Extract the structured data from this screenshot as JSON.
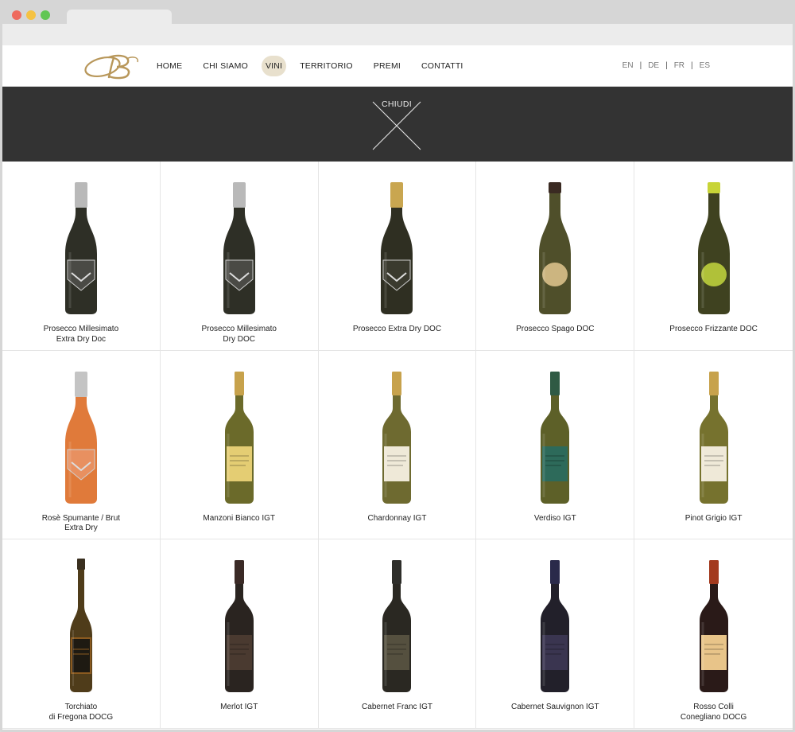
{
  "nav": {
    "items": [
      {
        "label": "HOME",
        "active": false
      },
      {
        "label": "CHI SIAMO",
        "active": false
      },
      {
        "label": "VINI",
        "active": true
      },
      {
        "label": "TERRITORIO",
        "active": false
      },
      {
        "label": "PREMI",
        "active": false
      },
      {
        "label": "CONTATTI",
        "active": false
      }
    ]
  },
  "languages": [
    "EN",
    "DE",
    "FR",
    "ES"
  ],
  "close_label": "CHIUDI",
  "colors": {
    "accent": "#e8e0cd",
    "logo_gold": "#b8975a",
    "dark_bar": "#333333"
  },
  "wines": [
    {
      "name_line1": "Prosecco Millesimato",
      "name_line2": "Extra Dry Doc",
      "bottle": "sparkling",
      "glass": "#2e2f26",
      "cap": "#b9b9b9",
      "label": "#4a4a45"
    },
    {
      "name_line1": "Prosecco Millesimato",
      "name_line2": "Dry DOC",
      "bottle": "sparkling",
      "glass": "#2e2f26",
      "cap": "#b9b9b9",
      "label": "#4a4a45"
    },
    {
      "name_line1": "Prosecco Extra Dry DOC",
      "name_line2": "",
      "bottle": "sparkling",
      "glass": "#2f2f22",
      "cap": "#c9a650",
      "label": "#3a3a2e"
    },
    {
      "name_line1": "Prosecco Spago DOC",
      "name_line2": "",
      "bottle": "spago",
      "glass": "#4f4f2a",
      "cap": "#3a2a22",
      "label": "#d9c08a"
    },
    {
      "name_line1": "Prosecco Frizzante DOC",
      "name_line2": "",
      "bottle": "spago",
      "glass": "#3f4220",
      "cap": "#c8d437",
      "label": "#bccf3c"
    },
    {
      "name_line1": "Rosè Spumante / Brut",
      "name_line2": "Extra Dry",
      "bottle": "sparkling",
      "glass": "#e07a3a",
      "cap": "#c4c4c4",
      "label": "#e89060"
    },
    {
      "name_line1": "Manzoni Bianco IGT",
      "name_line2": "",
      "bottle": "still",
      "glass": "#6b6a2a",
      "cap": "#c7a24c",
      "label": "#e4cd73"
    },
    {
      "name_line1": "Chardonnay IGT",
      "name_line2": "",
      "bottle": "still",
      "glass": "#6e6a30",
      "cap": "#c7a24c",
      "label": "#efe9d8"
    },
    {
      "name_line1": "Verdiso IGT",
      "name_line2": "",
      "bottle": "still",
      "glass": "#5d6028",
      "cap": "#2f5a44",
      "label": "#2d6a5a"
    },
    {
      "name_line1": "Pinot Grigio IGT",
      "name_line2": "",
      "bottle": "still",
      "glass": "#76722e",
      "cap": "#c7a24c",
      "label": "#efe9d8"
    },
    {
      "name_line1": "Torchiato",
      "name_line2": "di Fregona DOCG",
      "bottle": "tall",
      "glass": "#4f3c1a",
      "cap": "#3a3020",
      "label": "#8a5a20"
    },
    {
      "name_line1": "Merlot IGT",
      "name_line2": "",
      "bottle": "still",
      "glass": "#2a2420",
      "cap": "#3a2a26",
      "label": "#4a3a30"
    },
    {
      "name_line1": "Cabernet Franc IGT",
      "name_line2": "",
      "bottle": "still",
      "glass": "#2a2822",
      "cap": "#2e2e2a",
      "label": "#55503f"
    },
    {
      "name_line1": "Cabernet Sauvignon IGT",
      "name_line2": "",
      "bottle": "still",
      "glass": "#22202a",
      "cap": "#2a2a4a",
      "label": "#3a3550"
    },
    {
      "name_line1": "Rosso Colli",
      "name_line2": "Conegliano DOCG",
      "bottle": "still",
      "glass": "#2a1a18",
      "cap": "#a33a1e",
      "label": "#e8c489"
    }
  ]
}
